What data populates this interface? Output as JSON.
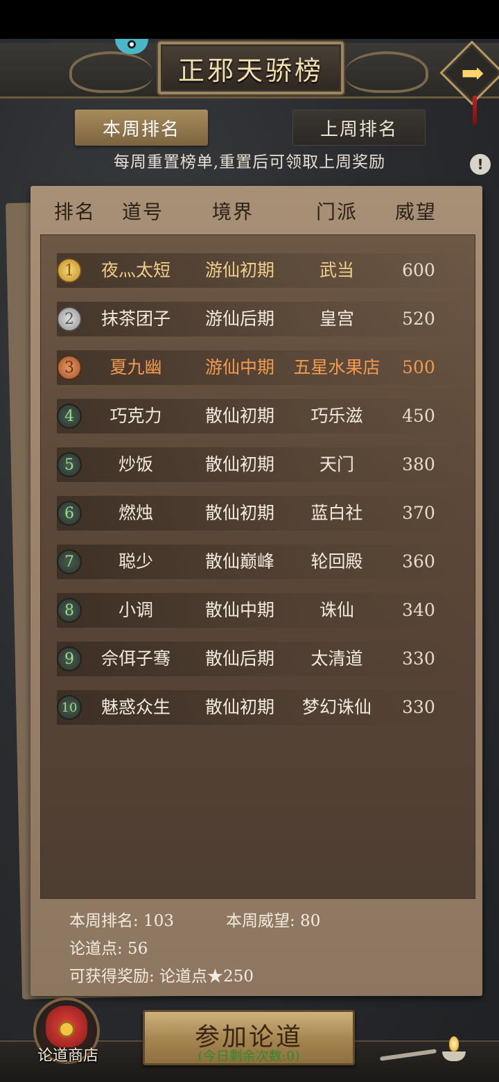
{
  "header": {
    "title": "正邪天骄榜",
    "next_icon": "arrow-right-icon"
  },
  "tabs": [
    {
      "label": "本周排名",
      "active": true
    },
    {
      "label": "上周排名",
      "active": false
    }
  ],
  "notice": "每周重置榜单,重置后可领取上周奖励",
  "info_icon": "!",
  "columns": [
    "排名",
    "道号",
    "境界",
    "门派",
    "威望"
  ],
  "rows": [
    {
      "rank": "1",
      "name": "夜灬太短",
      "realm": "游仙初期",
      "sect": "武当",
      "score": "600"
    },
    {
      "rank": "2",
      "name": "抹茶团子",
      "realm": "游仙后期",
      "sect": "皇宫",
      "score": "520"
    },
    {
      "rank": "3",
      "name": "夏九幽",
      "realm": "游仙中期",
      "sect": "五星水果店",
      "score": "500"
    },
    {
      "rank": "4",
      "name": "巧克力",
      "realm": "散仙初期",
      "sect": "巧乐滋",
      "score": "450"
    },
    {
      "rank": "5",
      "name": "炒饭",
      "realm": "散仙初期",
      "sect": "天门",
      "score": "380"
    },
    {
      "rank": "6",
      "name": "燃烛",
      "realm": "散仙初期",
      "sect": "蓝白社",
      "score": "370"
    },
    {
      "rank": "7",
      "name": "聪少",
      "realm": "散仙巅峰",
      "sect": "轮回殿",
      "score": "360"
    },
    {
      "rank": "8",
      "name": "小调",
      "realm": "散仙中期",
      "sect": "诛仙",
      "score": "340"
    },
    {
      "rank": "9",
      "name": "佘佴子骞",
      "realm": "散仙后期",
      "sect": "太清道",
      "score": "330"
    },
    {
      "rank": "10",
      "name": "魅惑众生",
      "realm": "散仙初期",
      "sect": "梦幻诛仙",
      "score": "330"
    }
  ],
  "stats": {
    "weekly_rank": "本周排名: 103",
    "weekly_prestige": "本周威望: 80",
    "points": "论道点: 56",
    "reward": "可获得奖励: 论道点★250"
  },
  "footer": {
    "shop_label": "论道商店",
    "join_label": "参加论道",
    "join_sub": "(今日剩余次数:0)"
  },
  "colors": {
    "gold_text": "#f1cf89",
    "orange_text": "#f39b4e",
    "green_rank": "#8fe08a"
  }
}
